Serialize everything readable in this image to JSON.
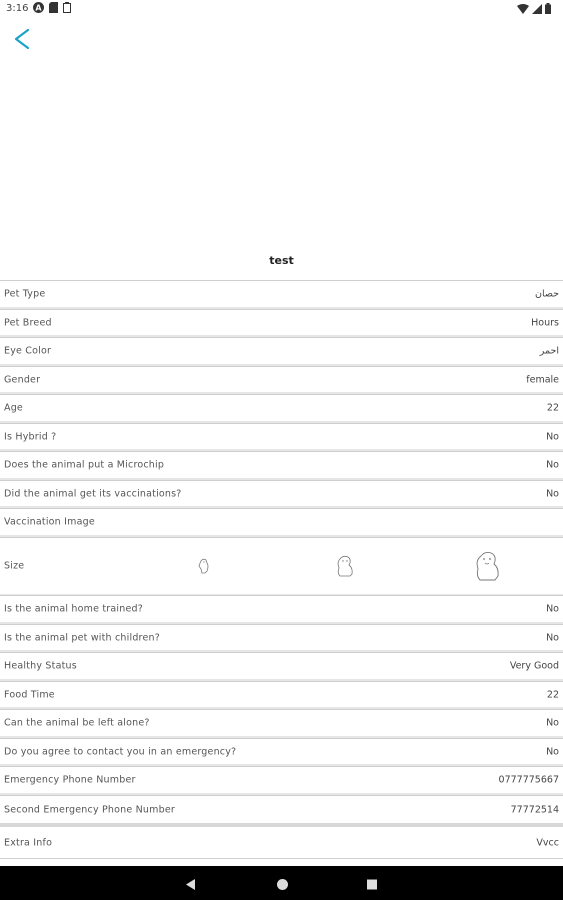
{
  "status_bar": {
    "time": "3:16",
    "left_icons": [
      "a-circle-icon",
      "sd-card-icon",
      "clipboard-icon"
    ],
    "right_icons": [
      "wifi-icon",
      "signal-icon",
      "battery-icon"
    ]
  },
  "header": {
    "back_icon": "chevron-left-icon",
    "accent_color": "#1aa3c8"
  },
  "pet_name": "test",
  "rows": [
    {
      "label": "Pet Type",
      "value": "حصان"
    },
    {
      "label": "Pet Breed",
      "value": "Hours"
    },
    {
      "label": "Eye Color",
      "value": "احمر"
    },
    {
      "label": "Gender",
      "value": "female"
    },
    {
      "label": "Age",
      "value": "22"
    },
    {
      "label": "Is Hybrid ?",
      "value": "No"
    },
    {
      "label": "Does the animal put a Microchip",
      "value": "No"
    },
    {
      "label": "Did the animal get its vaccinations?",
      "value": "No"
    },
    {
      "label": "Vaccination Image",
      "value": ""
    }
  ],
  "size_row": {
    "label": "Size",
    "icons": [
      "small-dog-icon",
      "medium-dog-icon",
      "large-dog-icon"
    ]
  },
  "rows2": [
    {
      "label": "Is the animal home trained?",
      "value": "No"
    },
    {
      "label": "Is the animal pet with children?",
      "value": "No"
    },
    {
      "label": "Healthy Status",
      "value": "Very Good"
    },
    {
      "label": "Food Time",
      "value": "22"
    },
    {
      "label": "Can the animal be left alone?",
      "value": "No"
    },
    {
      "label": "Do you agree to contact you in an emergency?",
      "value": "No"
    },
    {
      "label": "Emergency Phone Number",
      "value": "0777775667"
    },
    {
      "label": "Second Emergency Phone Number",
      "value": "77772514"
    }
  ],
  "extra": {
    "label": "Extra Info",
    "value": "Vvcc"
  },
  "nav_bar": [
    "back-triangle-icon",
    "home-circle-icon",
    "recents-square-icon"
  ]
}
